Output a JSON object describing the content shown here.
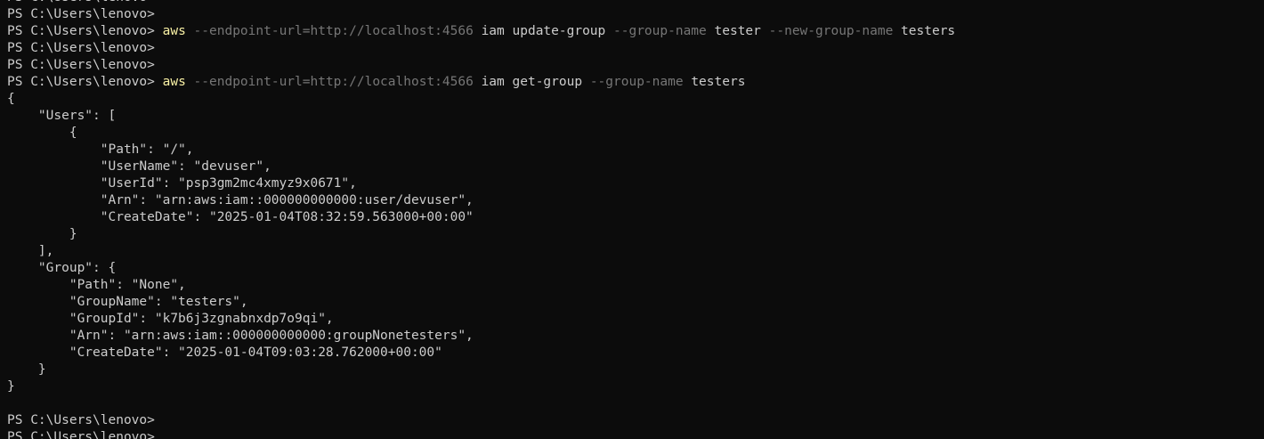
{
  "colors": {
    "background": "#0c0c0c",
    "text": "#cccccc",
    "command": "#f9f1a5",
    "parameter": "#767676"
  },
  "prompt": "PS C:\\Users\\lenovo> ",
  "command1": {
    "exe": "aws",
    "endpoint": "--endpoint-url=http://localhost:4566",
    "service": "iam",
    "action": "update-group",
    "flag1": "--group-name",
    "val1": "tester",
    "flag2": "--new-group-name",
    "val2": "testers"
  },
  "command2": {
    "exe": "aws",
    "endpoint": "--endpoint-url=http://localhost:4566",
    "service": "iam",
    "action": "get-group",
    "flag1": "--group-name",
    "val1": "testers"
  },
  "output": [
    "{",
    "    \"Users\": [",
    "        {",
    "            \"Path\": \"/\",",
    "            \"UserName\": \"devuser\",",
    "            \"UserId\": \"psp3gm2mc4xmyz9x0671\",",
    "            \"Arn\": \"arn:aws:iam::000000000000:user/devuser\",",
    "            \"CreateDate\": \"2025-01-04T08:32:59.563000+00:00\"",
    "        }",
    "    ],",
    "    \"Group\": {",
    "        \"Path\": \"None\",",
    "        \"GroupName\": \"testers\",",
    "        \"GroupId\": \"k7b6j3zgnabnxdp7o9qi\",",
    "        \"Arn\": \"arn:aws:iam::000000000000:groupNonetesters\",",
    "        \"CreateDate\": \"2025-01-04T09:03:28.762000+00:00\"",
    "    }",
    "}"
  ]
}
